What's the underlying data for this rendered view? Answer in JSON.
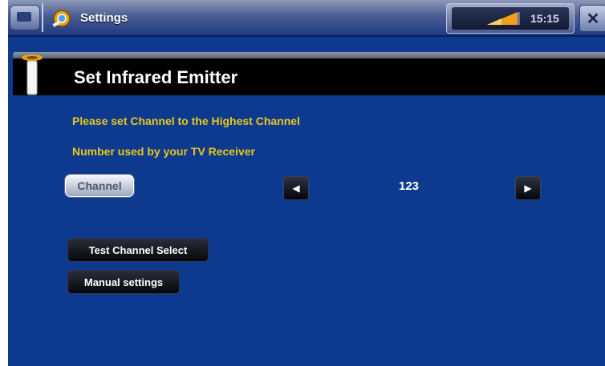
{
  "top_bar": {
    "app_title": "Settings",
    "clock": "15:15",
    "settings_icon": "settings-gear-icon",
    "signal_icon": "signal-strength-icon",
    "close_label": "✕",
    "close_icon": "close-icon"
  },
  "heading": {
    "title": "Set Infrared Emitter",
    "icon": "infrared-emitter-icon"
  },
  "instructions": {
    "line1": "Please set Channel to the Highest Channel",
    "line2": "Number used by your TV Receiver"
  },
  "channel": {
    "button_label": "Channel",
    "value": "123",
    "prev_glyph": "◀",
    "next_glyph": "▶"
  },
  "actions": {
    "test_label": "Test Channel Select",
    "manual_label": "Manual settings"
  },
  "colors": {
    "background": "#0d3a8e",
    "instruction_text": "#e6c81c",
    "heading_bg": "#000000"
  }
}
